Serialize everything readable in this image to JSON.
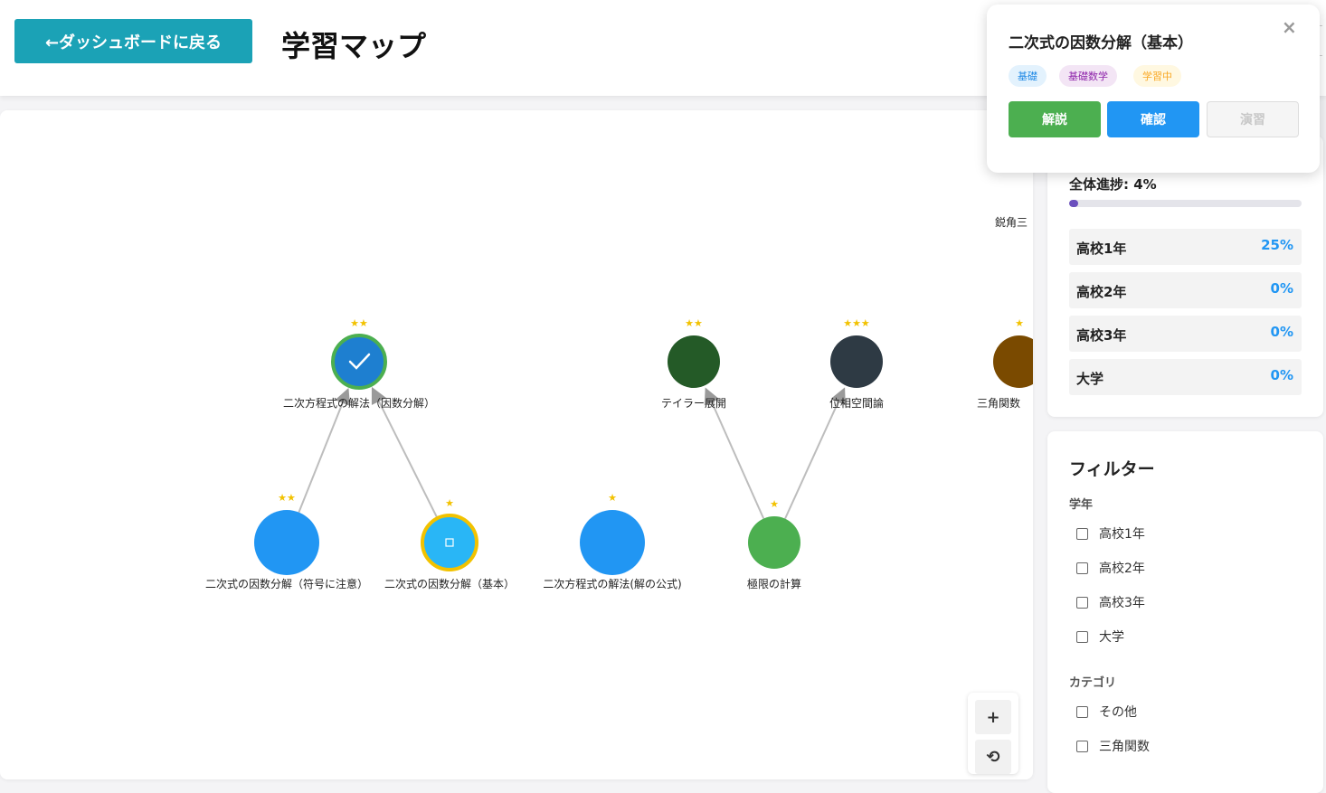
{
  "header": {
    "back_label": "←ダッシュボードに戻る",
    "title": "学習マップ"
  },
  "map": {
    "nodes": [
      {
        "id": "n1",
        "label": "二次方程式の解法（因数分解）",
        "stars": "★★",
        "color": "#1e7fd0",
        "ring": "#4caf50",
        "state": "completed",
        "icon": "check-icon"
      },
      {
        "id": "n2",
        "label": "テイラー展開",
        "stars": "★★",
        "color": "#245a27",
        "ring": "",
        "state": "locked"
      },
      {
        "id": "n3",
        "label": "位相空間論",
        "stars": "★★★",
        "color": "#2e3a44",
        "ring": "",
        "state": "locked"
      },
      {
        "id": "n4",
        "label": "三角関数",
        "stars": "★",
        "color": "#7a4a00",
        "ring": "",
        "state": "locked"
      },
      {
        "id": "n5",
        "label": "二次式の因数分解（符号に注意）",
        "stars": "★★",
        "color": "#2196f3",
        "ring": "",
        "state": "available"
      },
      {
        "id": "n6",
        "label": "二次式の因数分解（基本）",
        "stars": "★",
        "color": "#29b6f6",
        "ring": "#f2c200",
        "state": "learning",
        "icon": "square-icon"
      },
      {
        "id": "n7",
        "label": "二次方程式の解法(解の公式)",
        "stars": "★",
        "color": "#2196f3",
        "ring": "",
        "state": "available"
      },
      {
        "id": "n8",
        "label": "極限の計算",
        "stars": "★",
        "color": "#4caf50",
        "ring": "",
        "state": "available"
      }
    ],
    "edge_pairs": [
      [
        "n5",
        "n1"
      ],
      [
        "n6",
        "n1"
      ],
      [
        "n8",
        "n2"
      ],
      [
        "n8",
        "n3"
      ]
    ],
    "partial_label": "鋭角三",
    "zoom_in": "+",
    "zoom_reset": "⟲"
  },
  "progress": {
    "overall_label": "全体進捗: 4%",
    "overall_value": 0.04,
    "accent": "#6a4fbd",
    "grades": [
      {
        "name": "高校1年",
        "pct": "25%"
      },
      {
        "name": "高校2年",
        "pct": "0%"
      },
      {
        "name": "高校3年",
        "pct": "0%"
      },
      {
        "name": "大学",
        "pct": "0%"
      }
    ]
  },
  "filter": {
    "title": "フィルター",
    "grade_heading": "学年",
    "grades": [
      "高校1年",
      "高校2年",
      "高校3年",
      "大学"
    ],
    "category_heading": "カテゴリ",
    "categories": [
      "その他",
      "三角関数"
    ]
  },
  "popup": {
    "title": "二次式の因数分解（基本）",
    "close": "×",
    "tags": [
      {
        "label": "基礎",
        "bg": "#e3f2fd",
        "fg": "#1e88e5"
      },
      {
        "label": "基礎数学",
        "bg": "#f3e5f5",
        "fg": "#8e24aa"
      },
      {
        "label": "学習中",
        "bg": "#fff8e1",
        "fg": "#f9a825"
      }
    ],
    "buttons": {
      "explain": "解説",
      "confirm": "確認",
      "practice": "演習"
    }
  }
}
